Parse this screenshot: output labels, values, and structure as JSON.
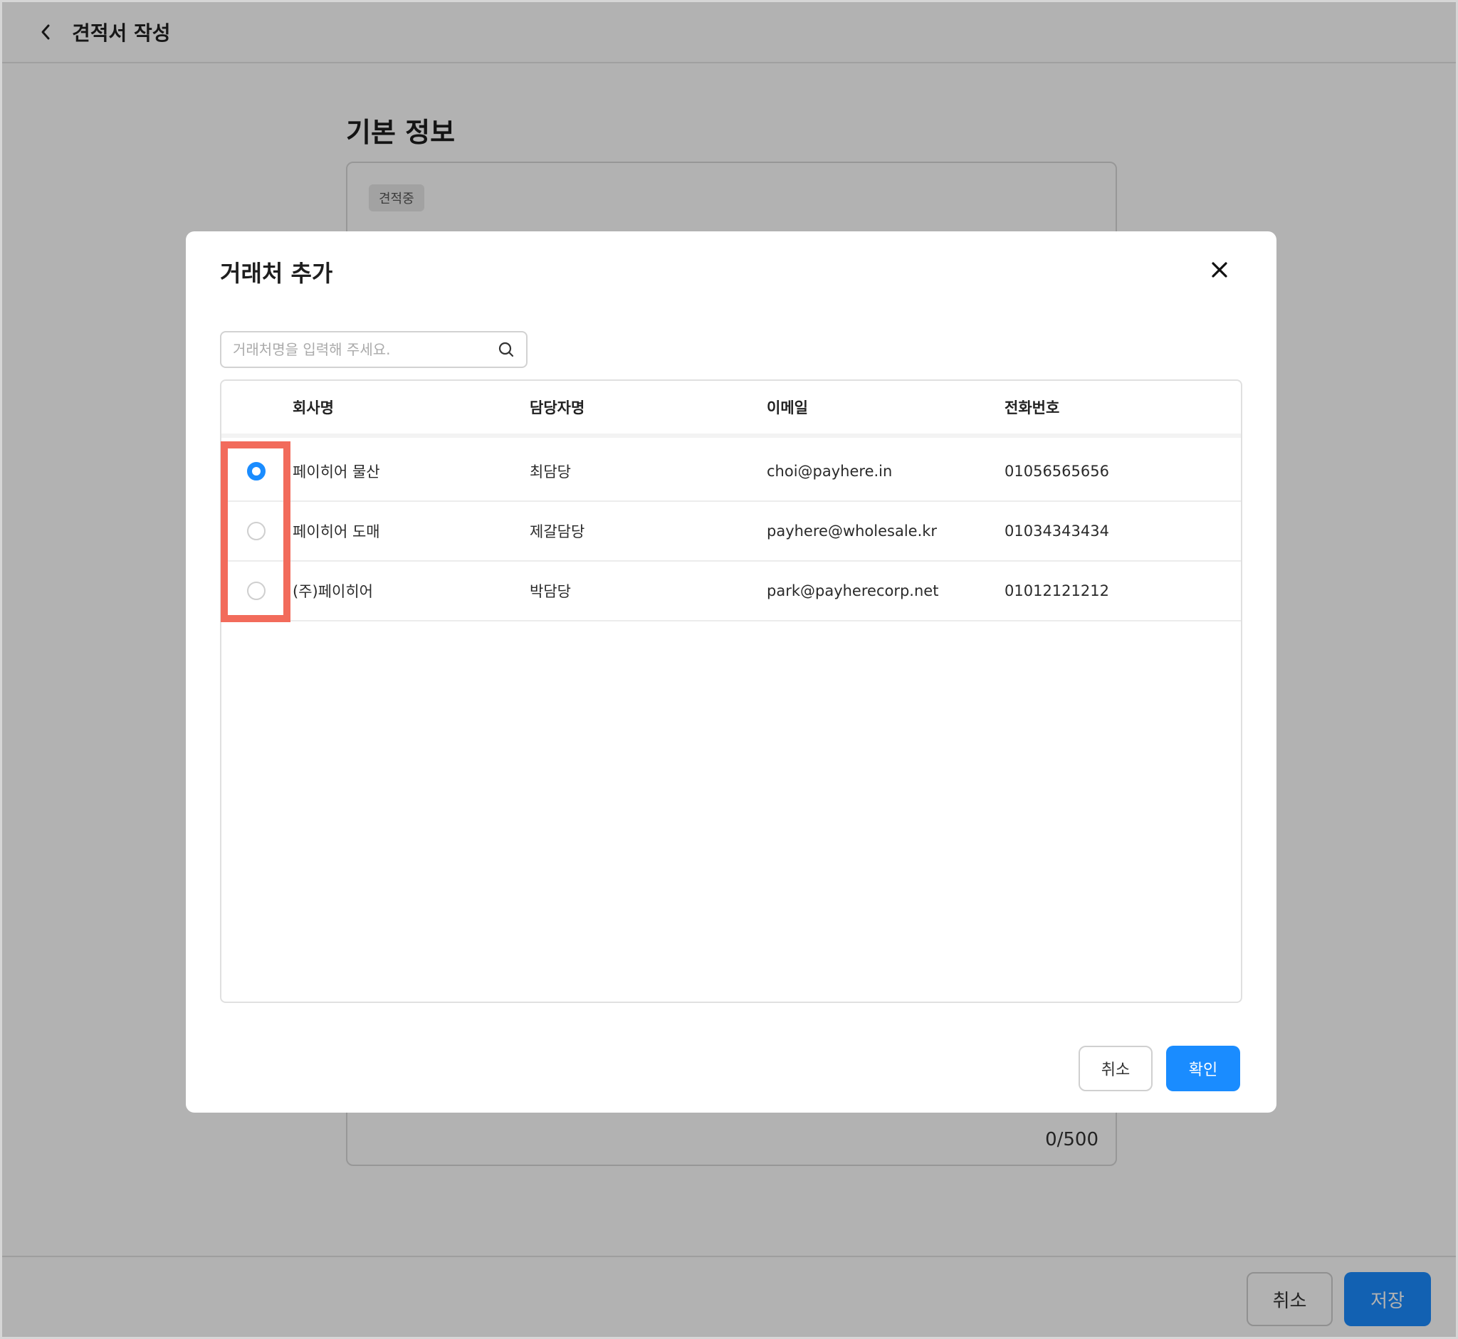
{
  "header": {
    "title": "견적서 작성"
  },
  "section": {
    "title": "기본 정보",
    "status_badge": "견적중",
    "char_count": "0/500"
  },
  "footer": {
    "cancel_label": "취소",
    "save_label": "저장"
  },
  "modal": {
    "title": "거래처 추가",
    "search": {
      "placeholder": "거래처명을 입력해 주세요.",
      "value": ""
    },
    "columns": [
      "회사명",
      "담당자명",
      "이메일",
      "전화번호"
    ],
    "rows": [
      {
        "company": "페이히어 물산",
        "manager": "최담당",
        "email": "choi@payhere.in",
        "phone": "01056565656",
        "selected": true
      },
      {
        "company": "페이히어 도매",
        "manager": "제갈담당",
        "email": "payhere@wholesale.kr",
        "phone": "01034343434",
        "selected": false
      },
      {
        "company": "(주)페이히어",
        "manager": "박담당",
        "email": "park@payherecorp.net",
        "phone": "01012121212",
        "selected": false
      }
    ],
    "cancel_label": "취소",
    "confirm_label": "확인"
  },
  "colors": {
    "accent": "#1a8cff",
    "highlight": "#f26b5b"
  }
}
